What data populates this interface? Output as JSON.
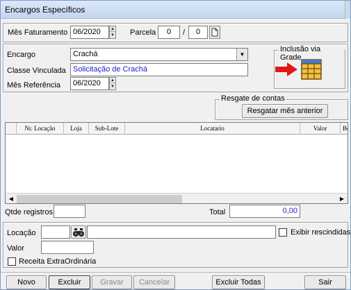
{
  "window": {
    "title": "Encargos Específicos"
  },
  "billing": {
    "mes_faturamento_label": "Mês Faturamento",
    "mes_faturamento_value": "06/2020",
    "parcela_label": "Parcela",
    "parcela_value": "0",
    "parcela_separator": "/",
    "parcela_total": "0"
  },
  "encargo": {
    "encargo_label": "Encargo",
    "encargo_value": "Crachá",
    "classe_label": "Classe Vinculada",
    "classe_value": "Solicitação de Crachá",
    "mes_ref_label": "Mês Referência",
    "mes_ref_value": "06/2020"
  },
  "inclusao": {
    "title": "Inclusão via Grade"
  },
  "resgate": {
    "title": "Resgate de contas",
    "button": "Resgatar mês anterior"
  },
  "grid": {
    "columns": [
      "Nr. Locação",
      "Loja",
      "Sub-Lote",
      "Locatario",
      "Valor",
      "Bo"
    ]
  },
  "totals": {
    "qtde_label": "Qtde registros",
    "qtde_value": "",
    "total_label": "Total",
    "total_value": "0,00"
  },
  "filters": {
    "locacao_label": "Locação",
    "locacao_code": "",
    "locacao_name": "",
    "exibir_rescindidas": "Exibir rescindidas",
    "valor_label": "Valor",
    "valor_value": "",
    "receita_label": "Receita ExtraOrdinária"
  },
  "toolbar": {
    "novo": "Novo",
    "excluir": "Excluir",
    "gravar": "Gravar",
    "cancelar": "Cancelar",
    "excluir_todas": "Excluir Todas",
    "sair": "Sair"
  },
  "colors": {
    "link_text": "#1a1acc",
    "arrow_red": "#e01818",
    "grid_icon": "#e8a020"
  }
}
